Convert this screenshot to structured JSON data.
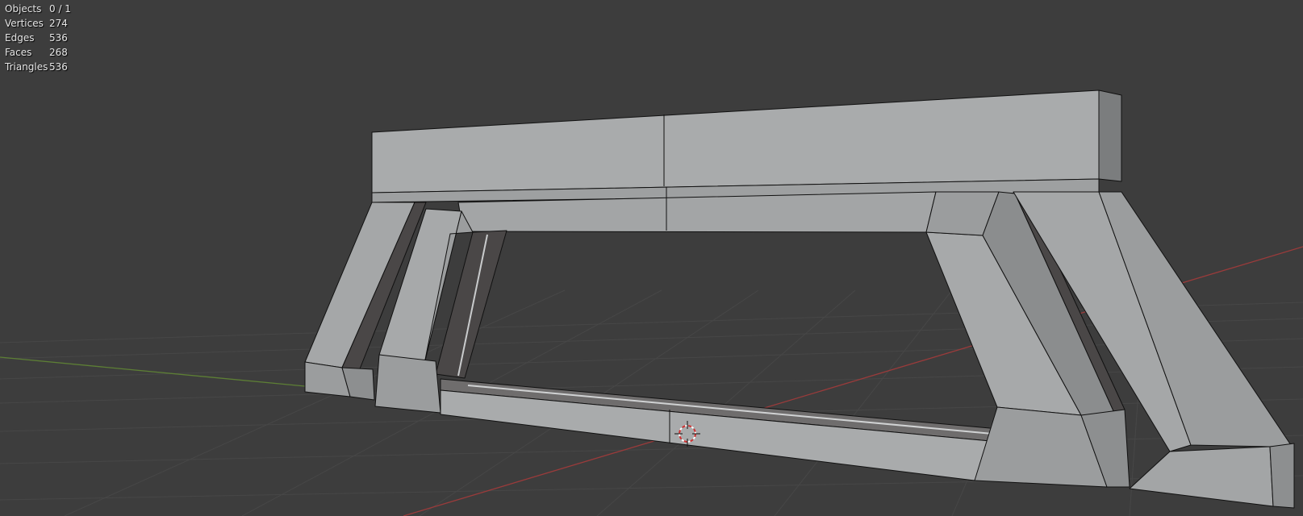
{
  "stats": {
    "rows": [
      {
        "label": "Objects",
        "value": "0 / 1"
      },
      {
        "label": "Vertices",
        "value": "274"
      },
      {
        "label": "Edges",
        "value": "536"
      },
      {
        "label": "Faces",
        "value": "268"
      },
      {
        "label": "Triangles",
        "value": "536"
      }
    ]
  },
  "colors": {
    "background": "#3d3d3d",
    "grid": "#474747",
    "x_axis": "#9a3b3b",
    "y_axis": "#5d7f35",
    "mesh_light": "#a7a9aa",
    "mesh_mid": "#8d8f90",
    "mesh_dark": "#4a4747",
    "edge": "#111111",
    "cursor": "#d03030"
  },
  "icons": {
    "cursor": "3d-cursor-icon"
  }
}
